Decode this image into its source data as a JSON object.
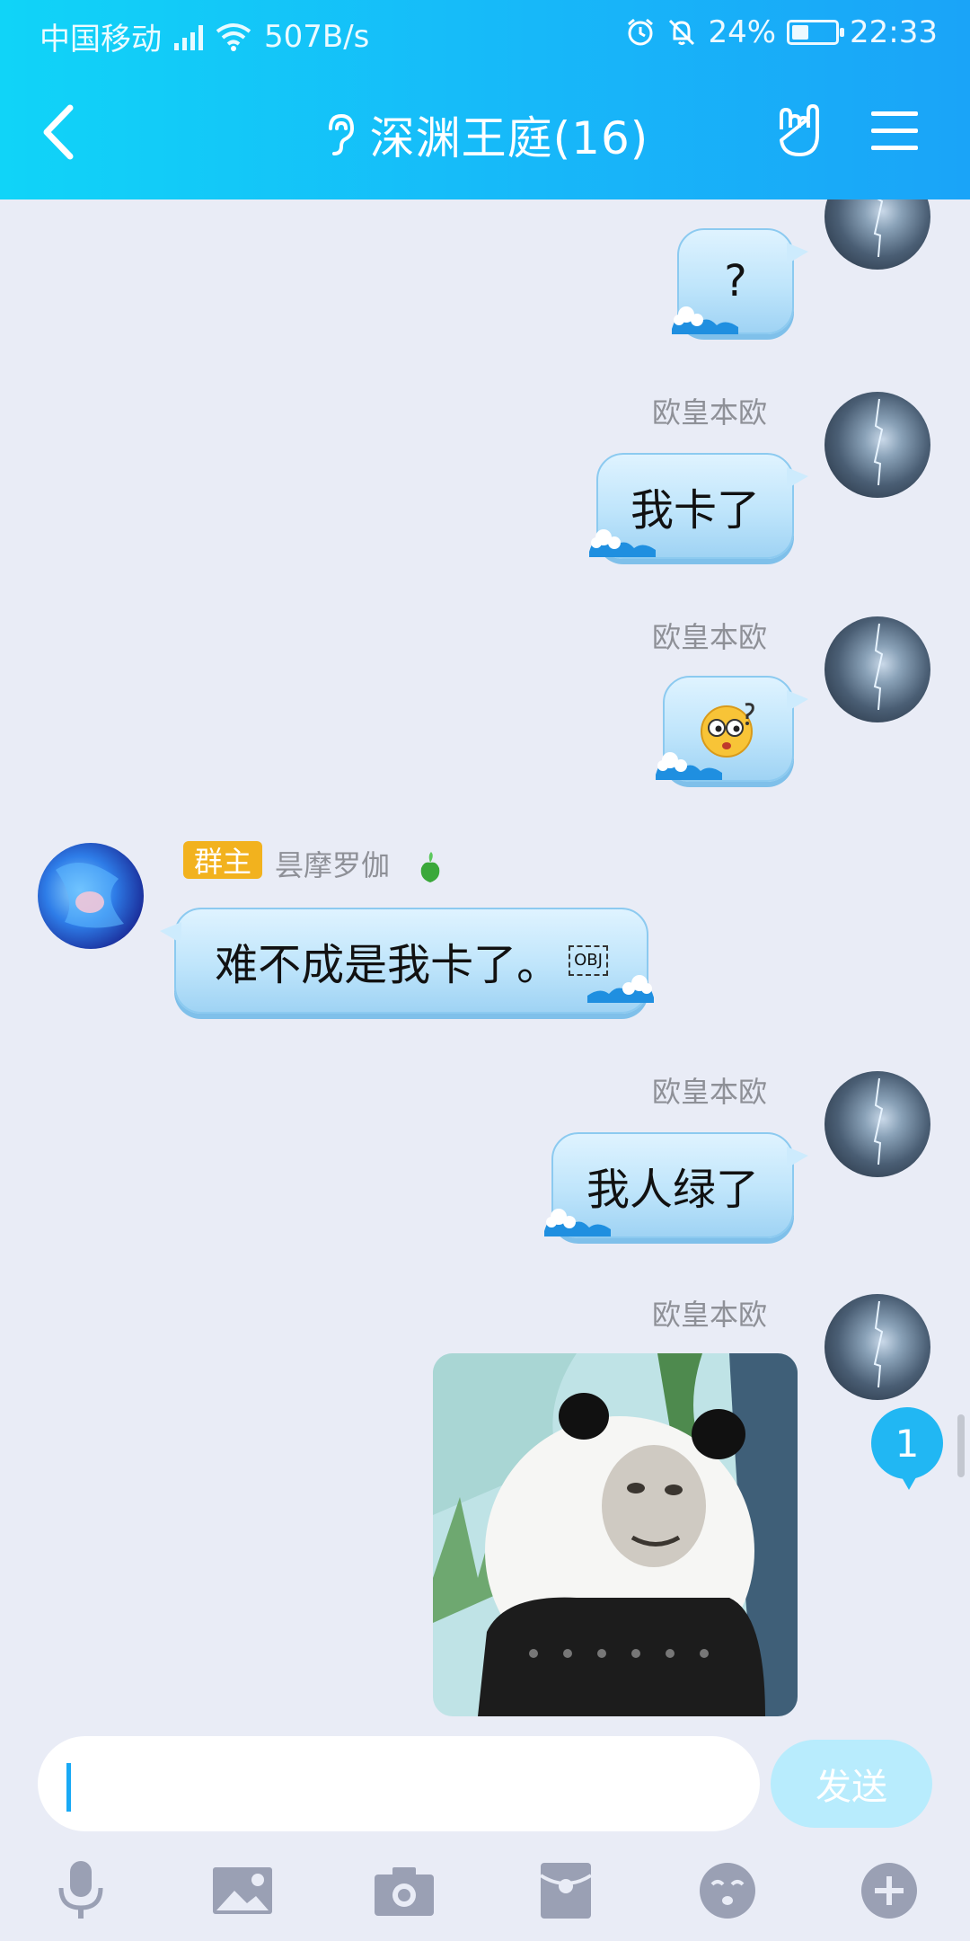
{
  "status": {
    "carrier": "中国移动",
    "speed": "507B/s",
    "battery": "24%",
    "time": "22:33"
  },
  "header": {
    "title": "深渊王庭(16)"
  },
  "messages": [
    {
      "text": "?"
    },
    {
      "sender": "欧皇本欧",
      "text": "我卡了"
    },
    {
      "sender": "欧皇本欧"
    },
    {
      "role": "群主",
      "sender": "昙摩罗伽",
      "text": "难不成是我卡了。",
      "obj": "OBJ"
    },
    {
      "sender": "欧皇本欧",
      "text": "我人绿了"
    },
    {
      "sender": "欧皇本欧"
    }
  ],
  "unread_count": "1",
  "input": {
    "placeholder": "",
    "send_label": "发送"
  },
  "icons": [
    "back-arrow",
    "ear",
    "hand-gesture",
    "menu",
    "microphone",
    "image",
    "camera",
    "red-packet",
    "emoji",
    "plus"
  ],
  "colors": {
    "header_start": "#10d4f8",
    "header_end": "#1aa4f8",
    "bubble": "#bfe5fb",
    "badge": "#f2b21e",
    "accent": "#19a9f5"
  }
}
